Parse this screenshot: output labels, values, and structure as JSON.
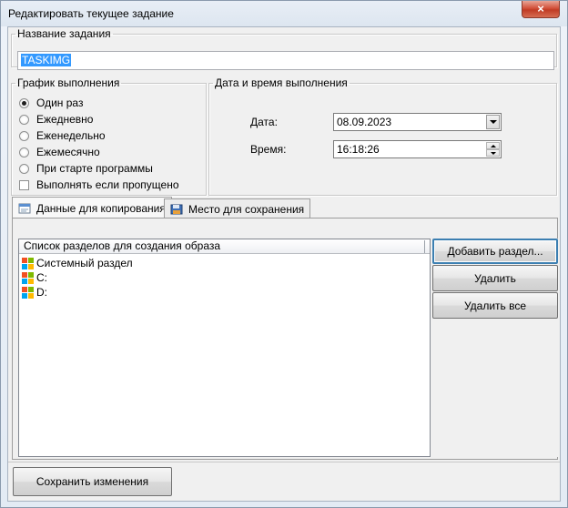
{
  "window": {
    "title": "Редактировать текущее задание",
    "close_glyph": "×"
  },
  "task_name": {
    "legend": "Название задания",
    "value": "TASKIMG"
  },
  "schedule": {
    "legend": "График выполнения",
    "options": [
      {
        "label": "Один раз",
        "selected": true
      },
      {
        "label": "Ежедневно",
        "selected": false
      },
      {
        "label": "Еженедельно",
        "selected": false
      },
      {
        "label": "Ежемесячно",
        "selected": false
      },
      {
        "label": "При старте программы",
        "selected": false
      }
    ],
    "missed_checkbox": {
      "label": "Выполнять если пропущено",
      "checked": false
    }
  },
  "datetime": {
    "legend": "Дата и время выполнения",
    "date_label": "Дата:",
    "date_value": "08.09.2023",
    "time_label": "Время:",
    "time_value": "16:18:26"
  },
  "tabs": [
    {
      "label": "Данные для копирования",
      "icon": "document-icon",
      "active": true
    },
    {
      "label": "Место для сохранения",
      "icon": "disk-icon",
      "active": false
    }
  ],
  "partition_list": {
    "header": "Список разделов для создания образа",
    "items": [
      {
        "label": "Системный раздел",
        "icon": "windows-logo-icon"
      },
      {
        "label": "C:",
        "icon": "windows-logo-icon"
      },
      {
        "label": "D:",
        "icon": "windows-logo-icon"
      }
    ]
  },
  "side_buttons": {
    "add": "Добавить раздел...",
    "remove": "Удалить",
    "remove_all": "Удалить все"
  },
  "footer": {
    "save": "Сохранить изменения"
  }
}
